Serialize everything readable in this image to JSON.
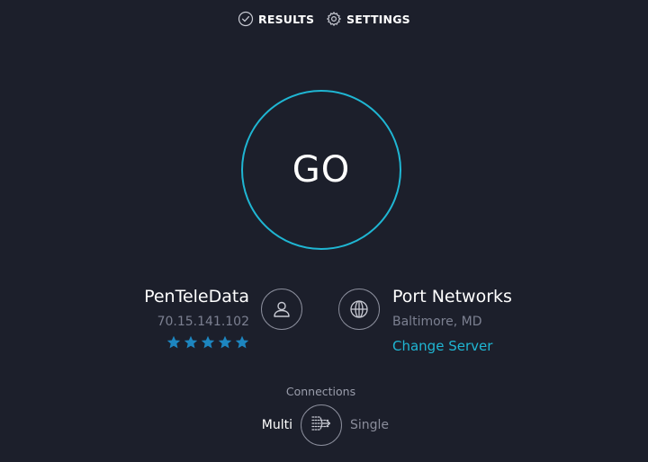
{
  "nav": {
    "results_label": "RESULTS",
    "results_icon": "check-circle-icon",
    "settings_label": "SETTINGS",
    "settings_icon": "gear-icon"
  },
  "go_button": {
    "label": "GO"
  },
  "isp": {
    "name": "PenTeleData",
    "ip": "70.15.141.102",
    "rating_stars": 5,
    "icon": "user-icon"
  },
  "server": {
    "name": "Port Networks",
    "location": "Baltimore, MD",
    "change_label": "Change Server",
    "icon": "globe-icon"
  },
  "connections": {
    "title": "Connections",
    "multi_label": "Multi",
    "single_label": "Single",
    "selected": "Multi",
    "icon": "connections-toggle-icon"
  },
  "colors": {
    "background": "#1c1f2b",
    "accent": "#1fb6d3",
    "star": "#1d86c0",
    "muted_text": "#7c8091"
  }
}
